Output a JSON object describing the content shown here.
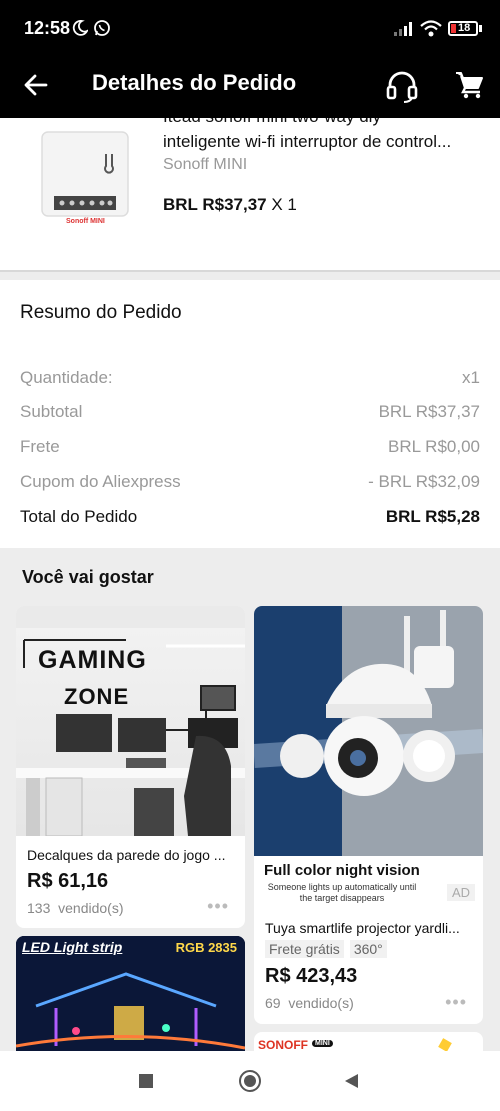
{
  "status": {
    "time": "12:58",
    "battery": "18"
  },
  "header": {
    "title": "Detalhes do Pedido"
  },
  "product": {
    "title_line1": "Itead sonoff mini two-way diy",
    "title_line2": "inteligente wi-fi interruptor de control...",
    "variant": "Sonoff MINI",
    "thumb_label": "Sonoff MINI",
    "price": "BRL R$37,37",
    "qty": "X 1"
  },
  "summary": {
    "title": "Resumo do Pedido",
    "rows": [
      {
        "label": "Quantidade:",
        "value": "x1"
      },
      {
        "label": "Subtotal",
        "value": "BRL R$37,37"
      },
      {
        "label": "Frete",
        "value": "BRL R$0,00"
      },
      {
        "label": "Cupom do Aliexpress",
        "value": "- BRL R$32,09"
      }
    ],
    "total_label": "Total do Pedido",
    "total_value": "BRL R$5,28"
  },
  "recommendations": {
    "title": "Você vai gostar",
    "items": [
      {
        "image_text_1": "GAMING",
        "image_text_2": "ZONE",
        "name": "Decalques da parede do jogo ...",
        "price": "R$ 61,16",
        "sold_count": "133",
        "sold_label": "vendido(s)"
      },
      {
        "image_headline": "Full color night vision",
        "image_caption_1": "Someone lights up automatically until",
        "image_caption_2": "the target disappears",
        "ad_badge": "AD",
        "name": "Tuya smartlife projector yardli...",
        "tags": [
          "Frete grátis",
          "360°"
        ],
        "price": "R$ 423,43",
        "sold_count": "69",
        "sold_label": "vendido(s)"
      },
      {
        "image_text_1": "LED Light strip",
        "image_text_2": "RGB 2835"
      },
      {
        "image_text_1": "SONOFF",
        "image_text_2": "MINI"
      }
    ]
  }
}
